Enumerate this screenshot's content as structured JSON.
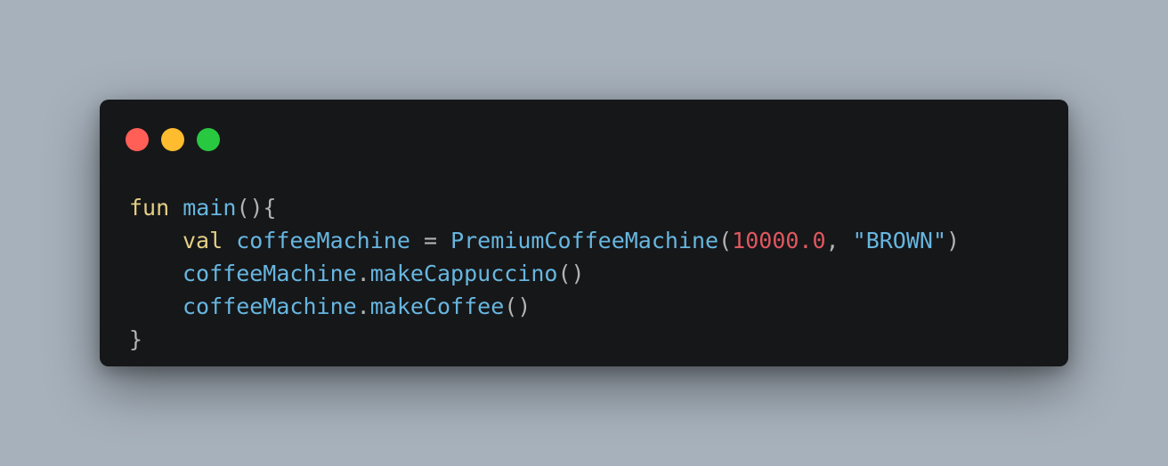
{
  "window_controls": {
    "close": {
      "color": "#ff5f57",
      "icon": "close-dot"
    },
    "minimize": {
      "color": "#febc2e",
      "icon": "minimize-dot"
    },
    "zoom": {
      "color": "#28c840",
      "icon": "zoom-dot"
    }
  },
  "colors": {
    "background": "#a7b1bc",
    "window": "#161719",
    "keyword": "#e5cf86",
    "identifier": "#67b6e0",
    "number": "#e0575f",
    "punctuation": "#b3b3b3"
  },
  "code": {
    "language": "kotlin",
    "lines": [
      {
        "tokens": [
          {
            "type": "kw",
            "text": "fun"
          },
          {
            "type": "space",
            "text": " "
          },
          {
            "type": "fn",
            "text": "main"
          },
          {
            "type": "op",
            "text": "()"
          },
          {
            "type": "op",
            "text": "{"
          }
        ]
      },
      {
        "indent": true,
        "tokens": [
          {
            "type": "kw",
            "text": "val"
          },
          {
            "type": "space",
            "text": " "
          },
          {
            "type": "fn",
            "text": "coffeeMachine"
          },
          {
            "type": "space",
            "text": " "
          },
          {
            "type": "op",
            "text": "="
          },
          {
            "type": "space",
            "text": " "
          },
          {
            "type": "fn",
            "text": "PremiumCoffeeMachine"
          },
          {
            "type": "op",
            "text": "("
          },
          {
            "type": "num",
            "text": "10000.0"
          },
          {
            "type": "op",
            "text": ","
          },
          {
            "type": "space",
            "text": " "
          },
          {
            "type": "str",
            "text": "\"BROWN\""
          },
          {
            "type": "op",
            "text": ")"
          }
        ]
      },
      {
        "indent": true,
        "tokens": [
          {
            "type": "fn",
            "text": "coffeeMachine"
          },
          {
            "type": "op",
            "text": "."
          },
          {
            "type": "fn",
            "text": "makeCappuccino"
          },
          {
            "type": "op",
            "text": "()"
          }
        ]
      },
      {
        "indent": true,
        "tokens": [
          {
            "type": "fn",
            "text": "coffeeMachine"
          },
          {
            "type": "op",
            "text": "."
          },
          {
            "type": "fn",
            "text": "makeCoffee"
          },
          {
            "type": "op",
            "text": "()"
          }
        ]
      },
      {
        "tokens": [
          {
            "type": "op",
            "text": "}"
          }
        ]
      }
    ]
  }
}
